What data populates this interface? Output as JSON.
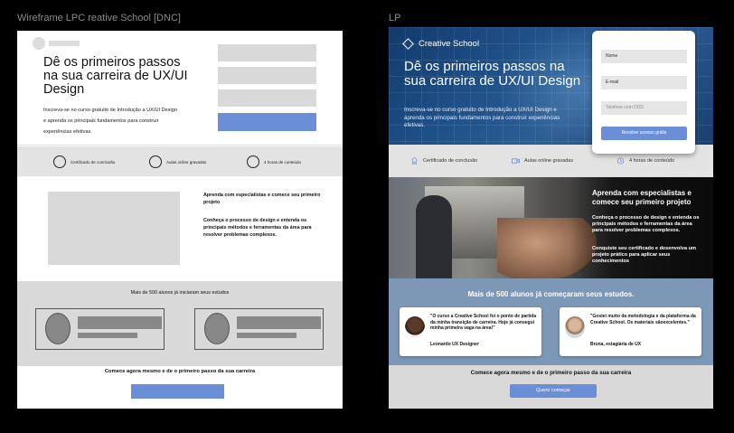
{
  "wireframe": {
    "frame_label": "Wireframe LPC reative School [DNC]",
    "hero": {
      "title": "Dê os primeiros passos na sua carreira de UX/UI Design",
      "subtitle": "Inscreva-se no curso gratuito de Introdução a UX/UI Design e aprenda os principais fundamentos para construir experiências efetivas."
    },
    "badges": [
      "Certificado de conclusão",
      "Aulas online gravadas",
      "4 horas de conteúdo"
    ],
    "feature": {
      "text1": "Aprenda com especialistas e comece seu primeiro projeto",
      "text2": "Conheça o processo de design e entenda os principais métodos e ferramentas da área para resolver problemas complexos."
    },
    "testimonials_title": "Mais de 500 alunos já iniciaram seus estudos",
    "cta_text": "Comece agora mesmo e de o primeiro passo da sua carreira"
  },
  "lp": {
    "frame_label": "LP",
    "brand": "Creative School",
    "hero": {
      "title": "Dê os primeiros passos na sua carreira de UX/UI Design",
      "subtitle": "Inscreva-se no curso gratuito de Introdução a UX/UI Design e aprenda os principais fundamentos para construir experiências efetivas."
    },
    "form": {
      "name_value": "Nome",
      "email_value": "E-mail",
      "phone_placeholder": "Telefone com DDD",
      "submit_label": "Receber acesso grátis"
    },
    "badges": [
      "Certificado de conclusão",
      "Aulas online gravadas",
      "4 horas de conteúdo"
    ],
    "feature": {
      "heading": "Aprenda com especialistas e comece seu primeiro projeto",
      "text1": "Conheça o processo de design e entenda os principais métodos e ferramentas da área para resolver problemas complexos.",
      "text2": "Conquiste seu certificado e desenvolva um projeto prático para aplicar seus conhecimentos"
    },
    "testimonials_title": "Mais de 500 alunos já começaram seus estudos.",
    "testimonials": [
      {
        "quote": "\"O curso a Creative School foi o ponto de partida da minha transição de carreira. Hoje já consegui minha primeira vaga na área!\"",
        "author": "Leonardo UX Designer"
      },
      {
        "quote": "\"Gostei muito da metodologia e da plataforma da Creative School. Os materiais sãoexcelentes.\"",
        "author": "Bruna, estagiária de UX"
      }
    ],
    "cta_text": "Comece agora mesmo e de o primeiro passo da sua carreira",
    "cta_button": "Quero começar"
  },
  "colors": {
    "accent": "#6b8fd6",
    "testimonial_bg": "#7c98b6",
    "hero_blue": "#1f5189"
  },
  "icons": [
    "certificate-icon",
    "video-camera-icon",
    "clock-icon",
    "diamond-logo-icon"
  ]
}
